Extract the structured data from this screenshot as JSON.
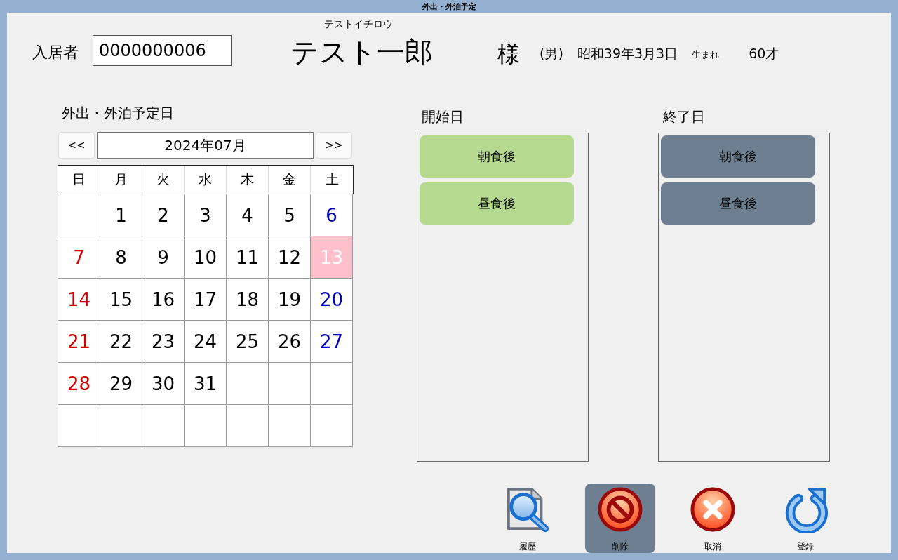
{
  "window": {
    "title": "外出・外泊予定"
  },
  "resident": {
    "label": "入居者",
    "id": "0000000006",
    "kana": "テストイチロウ",
    "name": "テスト一郎",
    "honorific": "様",
    "gender": "(男)",
    "birthdate": "昭和39年3月3日",
    "birth_suffix": "生まれ",
    "age": "60才"
  },
  "calendar": {
    "title": "外出・外泊予定日",
    "prev": "<<",
    "month": "2024年07月",
    "next": ">>",
    "weekdays": [
      "日",
      "月",
      "火",
      "水",
      "木",
      "金",
      "土"
    ],
    "weeks": [
      [
        {
          "kind": "blank",
          "selected": false
        },
        {
          "day": "1",
          "kind": "weekday",
          "selected": false
        },
        {
          "day": "2",
          "kind": "weekday",
          "selected": false
        },
        {
          "day": "3",
          "kind": "weekday",
          "selected": false
        },
        {
          "day": "4",
          "kind": "weekday",
          "selected": false
        },
        {
          "day": "5",
          "kind": "weekday",
          "selected": false
        },
        {
          "day": "6",
          "kind": "saturday",
          "selected": false
        }
      ],
      [
        {
          "day": "7",
          "kind": "sunday",
          "selected": false
        },
        {
          "day": "8",
          "kind": "weekday",
          "selected": false
        },
        {
          "day": "9",
          "kind": "weekday",
          "selected": false
        },
        {
          "day": "10",
          "kind": "weekday",
          "selected": false
        },
        {
          "day": "11",
          "kind": "weekday",
          "selected": false
        },
        {
          "day": "12",
          "kind": "weekday",
          "selected": false
        },
        {
          "day": "13",
          "kind": "saturday",
          "selected": true
        }
      ],
      [
        {
          "day": "14",
          "kind": "sunday",
          "selected": false
        },
        {
          "day": "15",
          "kind": "weekday",
          "selected": false
        },
        {
          "day": "16",
          "kind": "weekday",
          "selected": false
        },
        {
          "day": "17",
          "kind": "weekday",
          "selected": false
        },
        {
          "day": "18",
          "kind": "weekday",
          "selected": false
        },
        {
          "day": "19",
          "kind": "weekday",
          "selected": false
        },
        {
          "day": "20",
          "kind": "saturday",
          "selected": false
        }
      ],
      [
        {
          "day": "21",
          "kind": "sunday",
          "selected": false
        },
        {
          "day": "22",
          "kind": "weekday",
          "selected": false
        },
        {
          "day": "23",
          "kind": "weekday",
          "selected": false
        },
        {
          "day": "24",
          "kind": "weekday",
          "selected": false
        },
        {
          "day": "25",
          "kind": "weekday",
          "selected": false
        },
        {
          "day": "26",
          "kind": "weekday",
          "selected": false
        },
        {
          "day": "27",
          "kind": "saturday",
          "selected": false
        }
      ],
      [
        {
          "day": "28",
          "kind": "sunday",
          "selected": false
        },
        {
          "day": "29",
          "kind": "weekday",
          "selected": false
        },
        {
          "day": "30",
          "kind": "weekday",
          "selected": false
        },
        {
          "day": "31",
          "kind": "weekday",
          "selected": false
        },
        {
          "kind": "blank",
          "selected": false
        },
        {
          "kind": "blank",
          "selected": false
        },
        {
          "kind": "blank",
          "selected": false
        }
      ],
      [
        {
          "kind": "blank",
          "selected": false
        },
        {
          "kind": "blank",
          "selected": false
        },
        {
          "kind": "blank",
          "selected": false
        },
        {
          "kind": "blank",
          "selected": false
        },
        {
          "kind": "blank",
          "selected": false
        },
        {
          "kind": "blank",
          "selected": false
        },
        {
          "kind": "blank",
          "selected": false
        }
      ]
    ]
  },
  "panels": [
    {
      "title": "開始日",
      "color": "#b4d98f",
      "items": [
        "朝食後",
        "昼食後"
      ]
    },
    {
      "title": "終了日",
      "color": "#6e7f91",
      "items": [
        "朝食後",
        "昼食後"
      ]
    }
  ],
  "toolbar": [
    {
      "label": "履歴",
      "kind": "history",
      "selected": false
    },
    {
      "label": "削除",
      "kind": "delete",
      "selected": true
    },
    {
      "label": "取消",
      "kind": "cancel",
      "selected": false
    },
    {
      "label": "登録",
      "kind": "register",
      "selected": false
    }
  ]
}
